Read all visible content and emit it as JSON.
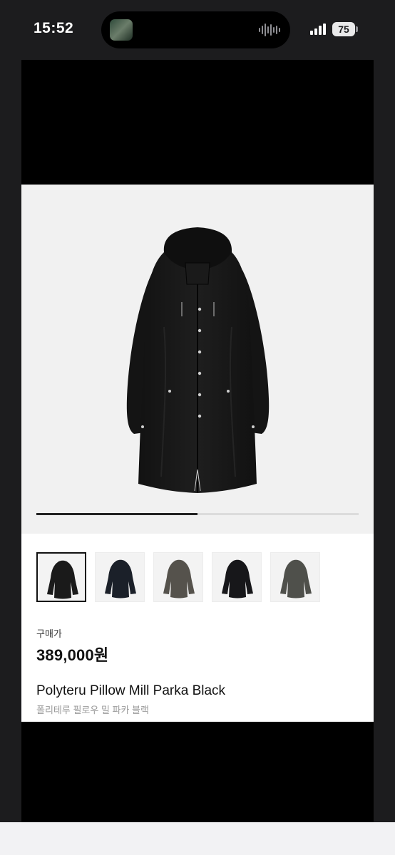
{
  "status_bar": {
    "time": "15:52",
    "battery": "75"
  },
  "product": {
    "image_slide_progress": 0.5,
    "thumbnails": [
      {
        "name": "parka-black",
        "color": "#1a1a1a",
        "selected": true
      },
      {
        "name": "parka-navy",
        "color": "#1b2029",
        "selected": false
      },
      {
        "name": "parka-charcoal",
        "color": "#55524c",
        "selected": false
      },
      {
        "name": "parka-black-alt",
        "color": "#17171a",
        "selected": false
      },
      {
        "name": "parka-olive-grey",
        "color": "#4f504b",
        "selected": false
      }
    ],
    "price_label": "구매가",
    "price": "389,000원",
    "name": "Polyteru Pillow Mill Parka Black",
    "name_ko": "폴리테루 필로우 밀 파카 블랙"
  },
  "colors": {
    "page_background": "#1c1c1e",
    "hero_background": "#f1f1f1",
    "coat": "#161616"
  }
}
